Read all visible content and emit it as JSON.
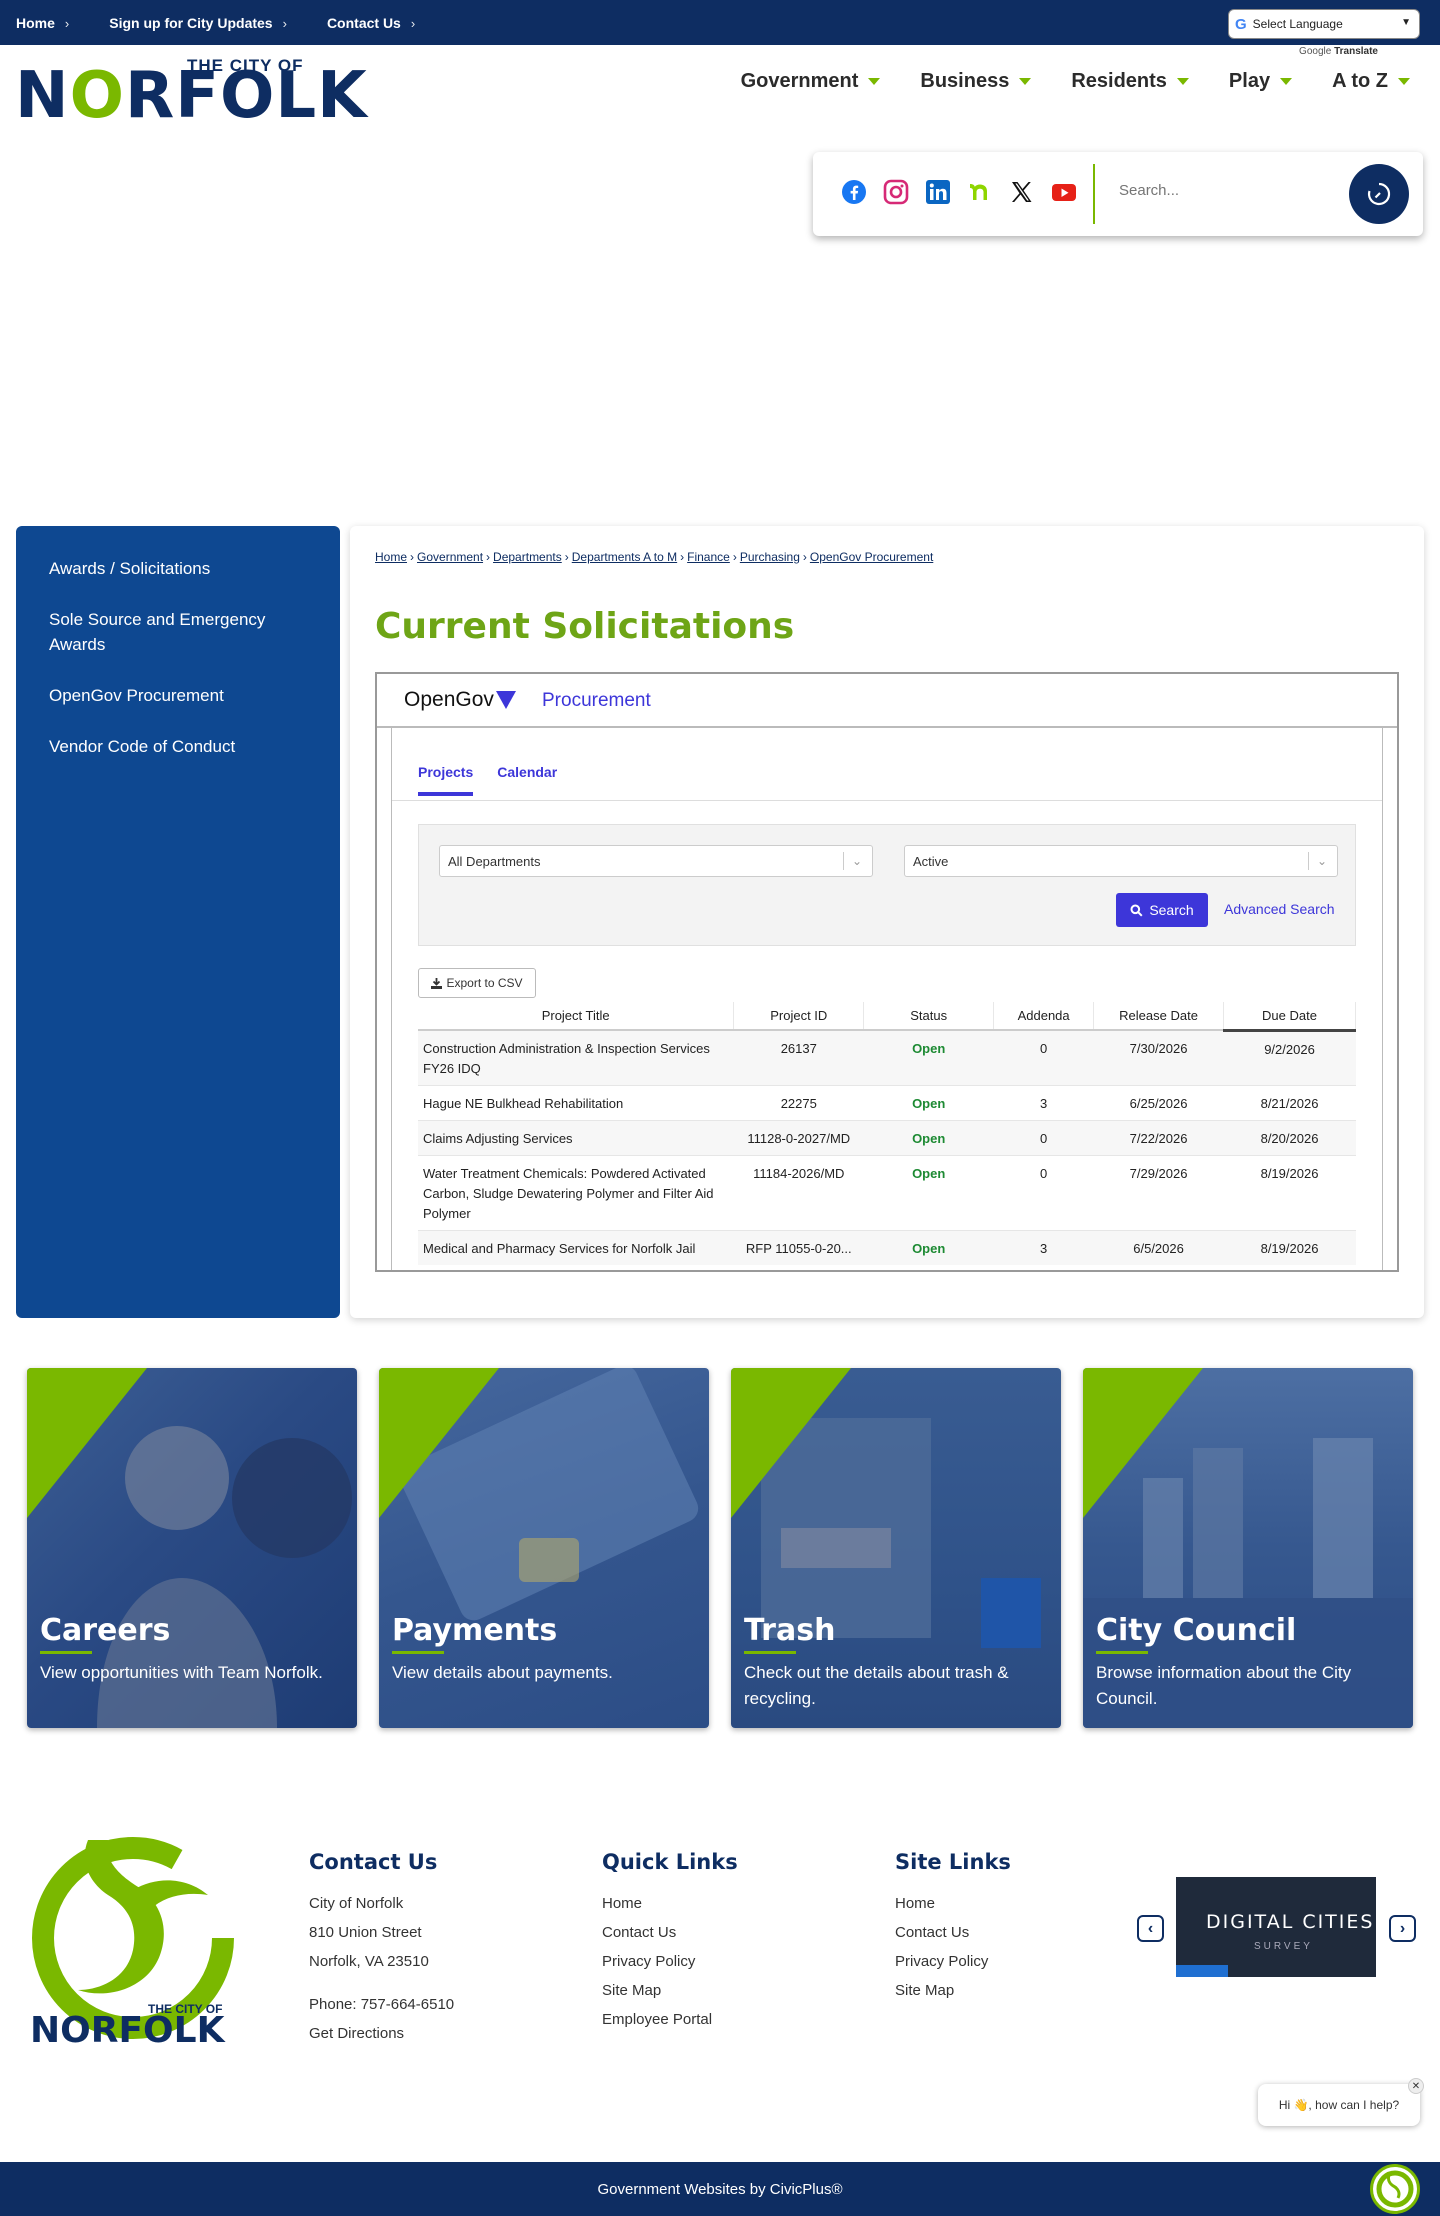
{
  "topbar": {
    "links": [
      "Home",
      "Sign up for City Updates",
      "Contact Us"
    ],
    "language_select": "Select Language",
    "google_translate": "Translate",
    "google_label": "Google"
  },
  "logo": {
    "small": "THE CITY OF",
    "big_n": "N",
    "big_o": "O",
    "big_rest": "RFOLK"
  },
  "main_nav": [
    "Government",
    "Business",
    "Residents",
    "Play",
    "A to Z"
  ],
  "search": {
    "placeholder": "Search..."
  },
  "sidebar": {
    "items": [
      "Awards / Solicitations",
      "Sole Source and Emergency Awards",
      "OpenGov Procurement",
      "Vendor Code of Conduct"
    ]
  },
  "breadcrumb": [
    "Home",
    "Government",
    "Departments",
    "Departments A to M",
    "Finance",
    "Purchasing",
    "OpenGov Procurement"
  ],
  "page_title": "Current Solicitations",
  "opengov": {
    "brand": "OpenGov",
    "product": "Procurement",
    "tabs": [
      "Projects",
      "Calendar"
    ],
    "department_filter": "All Departments",
    "status_filter": "Active",
    "search_button": "Search",
    "advanced_search": "Advanced Search",
    "export_button": "Export to CSV",
    "columns": [
      "Project Title",
      "Project ID",
      "Status",
      "Addenda",
      "Release Date",
      "Due Date"
    ],
    "rows": [
      {
        "title": "Construction Administration & Inspection Services FY26 IDQ",
        "id": "26137",
        "status": "Open",
        "addenda": "0",
        "release": "7/30/2026",
        "due": "9/2/2026"
      },
      {
        "title": "Hague NE Bulkhead Rehabilitation",
        "id": "22275",
        "status": "Open",
        "addenda": "3",
        "release": "6/25/2026",
        "due": "8/21/2026"
      },
      {
        "title": "Claims Adjusting Services",
        "id": "11128-0-2027/MD",
        "status": "Open",
        "addenda": "0",
        "release": "7/22/2026",
        "due": "8/20/2026"
      },
      {
        "title": "Water Treatment Chemicals: Powdered Activated Carbon, Sludge Dewatering Polymer and Filter Aid Polymer",
        "id": "11184-2026/MD",
        "status": "Open",
        "addenda": "0",
        "release": "7/29/2026",
        "due": "8/19/2026"
      },
      {
        "title": "Medical and Pharmacy Services for Norfolk Jail",
        "id": "RFP 11055-0-20...",
        "status": "Open",
        "addenda": "3",
        "release": "6/5/2026",
        "due": "8/19/2026"
      }
    ]
  },
  "cards": [
    {
      "title": "Careers",
      "desc": "View opportunities with Team Norfolk."
    },
    {
      "title": "Payments",
      "desc": "View details about payments."
    },
    {
      "title": "Trash",
      "desc": "Check out the details about trash & recycling."
    },
    {
      "title": "City Council",
      "desc": "Browse information about the City Council."
    }
  ],
  "footer": {
    "contact": {
      "heading": "Contact Us",
      "lines": [
        "City of Norfolk",
        "810 Union Street",
        "Norfolk, VA 23510"
      ],
      "phone": "Phone: 757-664-6510",
      "directions": "Get Directions"
    },
    "quick_links": {
      "heading": "Quick Links",
      "items": [
        "Home",
        "Contact Us",
        "Privacy Policy",
        "Site Map",
        "Employee Portal"
      ]
    },
    "site_links": {
      "heading": "Site Links",
      "items": [
        "Home",
        "Contact Us",
        "Privacy Policy",
        "Site Map"
      ]
    },
    "award": {
      "title": "DIGITAL CITIES",
      "sub": "SURVEY"
    },
    "logo_small": "THE CITY OF",
    "logo_big": "NORFOLK"
  },
  "chat": {
    "greeting": "Hi 👋, how can I help?"
  },
  "bottom_bar": "Government Websites by CivicPlus®",
  "colors": {
    "navy": "#0e2d62",
    "green": "#7ab800",
    "sidebar_blue": "#0e4891",
    "opengov_purple": "#3d36d9",
    "open_green": "#1d8a33"
  }
}
